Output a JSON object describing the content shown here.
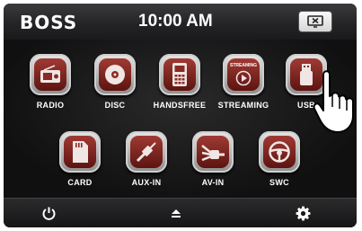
{
  "header": {
    "brand": "BOSS",
    "time": "10:00 AM",
    "screen_button_icon": "screen-off-icon"
  },
  "apps": [
    {
      "label": "RADIO",
      "icon": "radio-icon"
    },
    {
      "label": "DISC",
      "icon": "disc-icon"
    },
    {
      "label": "HANDSFREE",
      "icon": "phone-icon"
    },
    {
      "label": "STREAMING",
      "icon": "streaming-icon",
      "icon_text": "STREAMING"
    },
    {
      "label": "USB",
      "icon": "usb-icon"
    },
    {
      "label": "CARD",
      "icon": "sd-card-icon"
    },
    {
      "label": "AUX-IN",
      "icon": "aux-plug-icon"
    },
    {
      "label": "AV-IN",
      "icon": "av-cable-icon"
    },
    {
      "label": "SWC",
      "icon": "steering-wheel-icon"
    }
  ],
  "footer": {
    "power_icon": "power-icon",
    "eject_icon": "eject-icon",
    "settings_icon": "gear-icon"
  },
  "colors": {
    "tile_red": "#8a2a24",
    "bar_dark": "#1f1f21",
    "text": "#ffffff"
  }
}
